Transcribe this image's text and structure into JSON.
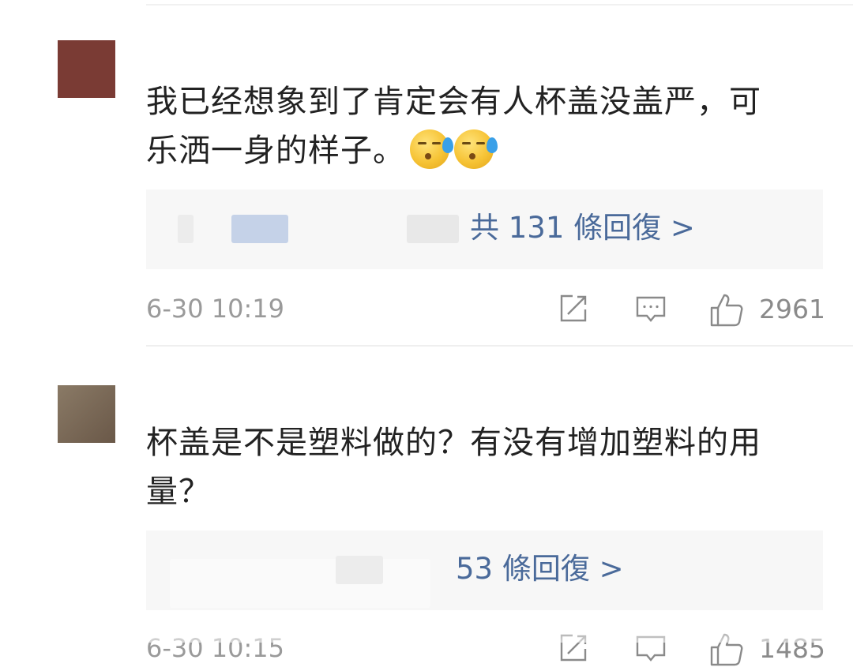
{
  "comments": [
    {
      "avatar_color": "#7a3b34",
      "text_line1": "我已经想象到了肯定会有人杯盖没盖严，可",
      "text_line2": "乐洒一身的样子。",
      "emojis": [
        "sweat-emoji",
        "sweat-emoji"
      ],
      "reply_summary": "共 131 條回復 >",
      "timestamp": "6-30 10:19",
      "like_count": "2961"
    },
    {
      "avatar_color": "#7b6a58",
      "text_line1": "杯盖是不是塑料做的？有没有增加塑料的用",
      "text_line2": "量？",
      "reply_summary": "53 條回復 >",
      "timestamp": "6-30 10:15",
      "like_count": "1485"
    }
  ],
  "icons": {
    "repost": "repost-icon",
    "comment": "comment-icon",
    "like": "thumbs-up-icon"
  },
  "colors": {
    "link": "#4a6a9a",
    "meta": "#9a9a9a"
  }
}
